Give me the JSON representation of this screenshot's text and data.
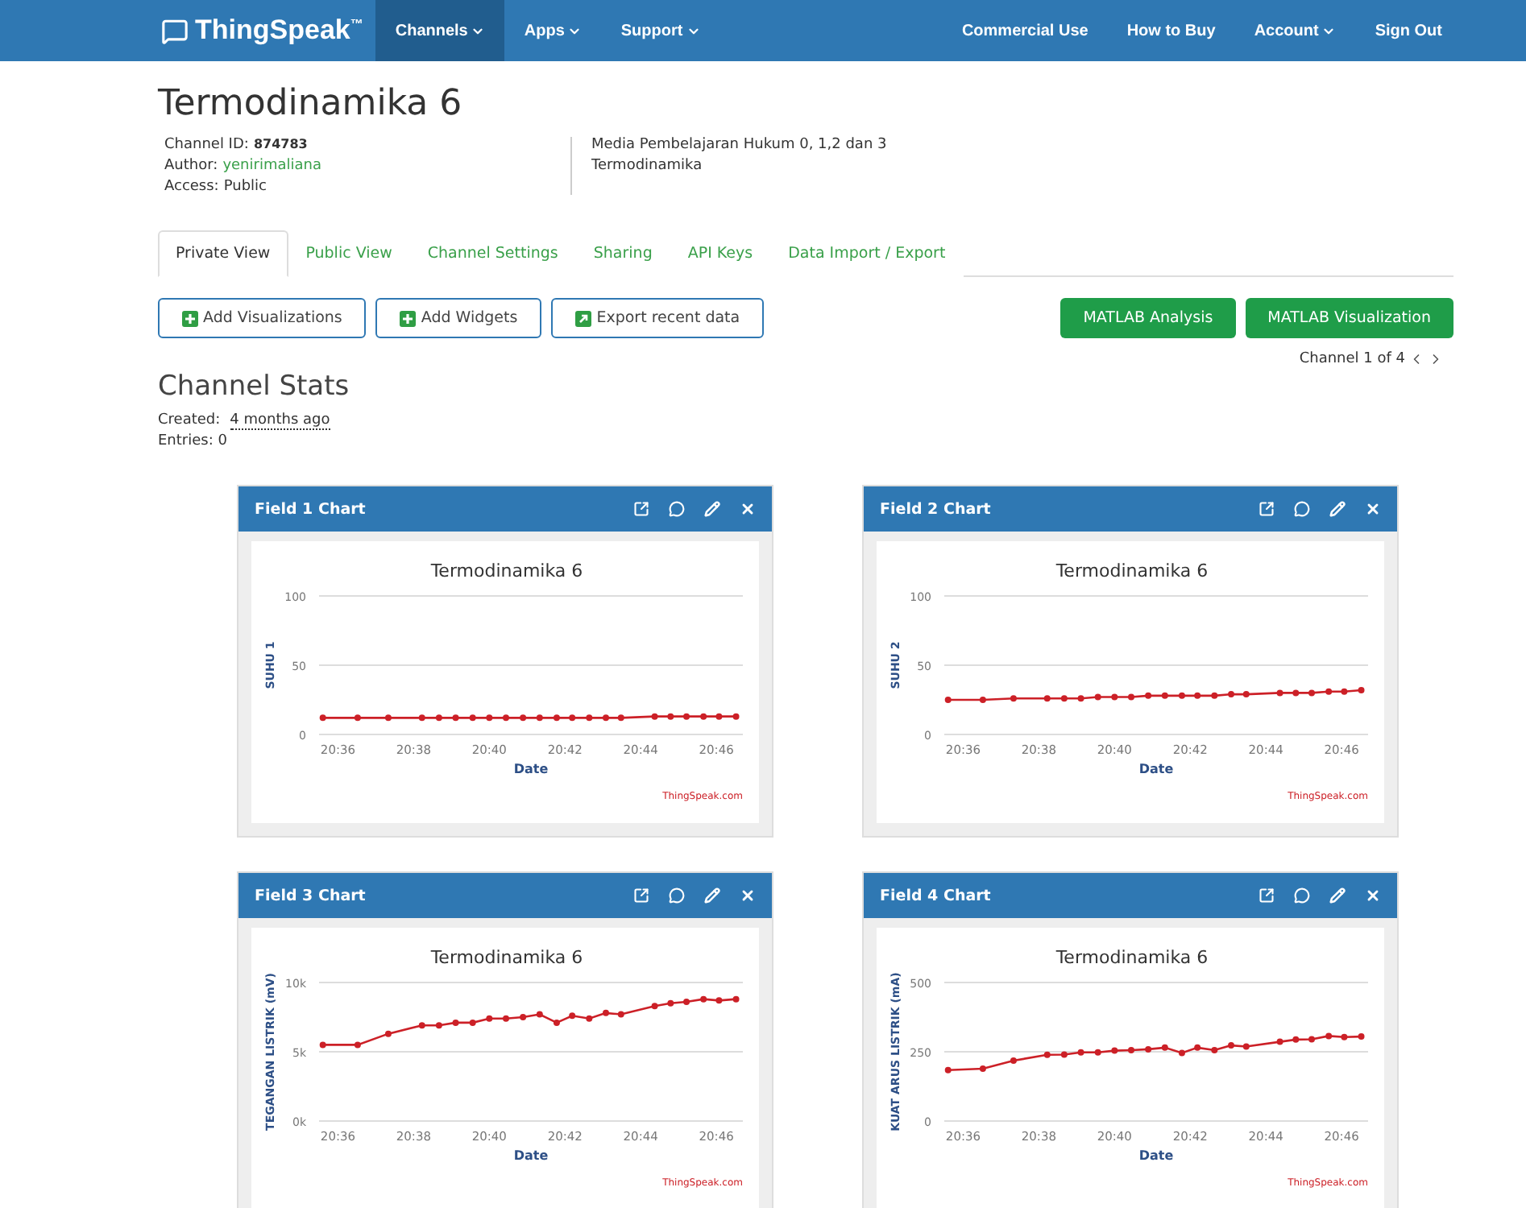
{
  "nav": {
    "logo": "ThingSpeak$^{™}$",
    "left": [
      {
        "label": "Channels",
        "menu": true,
        "selected": true
      },
      {
        "label": "Apps",
        "menu": true,
        "selected": false
      },
      {
        "label": "Support",
        "menu": true,
        "selected": false
      }
    ],
    "right": [
      {
        "label": "Commercial Use",
        "menu": false
      },
      {
        "label": "How to Buy",
        "menu": false
      },
      {
        "label": "Account",
        "menu": true
      },
      {
        "label": "Sign Out",
        "menu": false
      }
    ]
  },
  "channel": {
    "title": "Termodinamika 6",
    "meta": [
      {
        "label": "Channel ID:",
        "value": "874783",
        "kind": "bold"
      },
      {
        "label": "Author:",
        "value": "yenirimaliana",
        "kind": "link"
      },
      {
        "label": "Access:",
        "value": "Public",
        "kind": "plain"
      }
    ],
    "description": [
      "Media Pembelajaran Hukum 0, 1,2 dan 3",
      "Termodinamika"
    ]
  },
  "tabs": [
    {
      "label": "Private View",
      "selected": true
    },
    {
      "label": "Public View",
      "selected": false
    },
    {
      "label": "Channel Settings",
      "selected": false
    },
    {
      "label": "Sharing",
      "selected": false
    },
    {
      "label": "API Keys",
      "selected": false
    },
    {
      "label": "Data Import / Export",
      "selected": false
    }
  ],
  "actions": [
    {
      "label": "Add Visualizations",
      "kind": "plus"
    },
    {
      "label": "Add Widgets",
      "kind": "plus"
    },
    {
      "label": "Export recent data",
      "kind": "export"
    }
  ],
  "matlab": [
    "MATLAB Analysis",
    "MATLAB Visualization"
  ],
  "pager": "Channel 1 of 4",
  "stats": {
    "title": "Channel Stats",
    "created_label": "Created:",
    "created": "4 months ago",
    "entries": "Entries: 0"
  },
  "charts": [
    {
      "header": "Field 1 Chart",
      "credit": "ThingSpeak.com",
      "chart_data": {
        "type": "line",
        "title": "Termodinamika 6",
        "xlabel": "Date",
        "ylabel": "SUHU 1",
        "xlim": [
          1235.5,
          1246.7
        ],
        "ylim": [
          0,
          100
        ],
        "yticks": [
          0,
          50,
          100
        ],
        "xticks": [
          {
            "value": 1236,
            "label": "20:36"
          },
          {
            "value": 1238,
            "label": "20:38"
          },
          {
            "value": 1240,
            "label": "20:40"
          },
          {
            "value": 1242,
            "label": "20:42"
          },
          {
            "value": 1244,
            "label": "20:44"
          },
          {
            "value": 1246,
            "label": "20:46"
          }
        ],
        "x": [
          1235.6,
          1236.52,
          1237.33,
          1238.22,
          1238.67,
          1239.11,
          1239.56,
          1240,
          1240.44,
          1240.89,
          1241.33,
          1241.78,
          1242.19,
          1242.64,
          1243.08,
          1243.48,
          1244.37,
          1244.79,
          1245.21,
          1245.66,
          1246.07,
          1246.52
        ],
        "series": [
          {
            "color": "#cc2027",
            "marker": "circle",
            "values": [
              12,
              12,
              12,
              12,
              12,
              12,
              12,
              12,
              12,
              12,
              12,
              12,
              12,
              12,
              12,
              12,
              13,
              13,
              13,
              13,
              13,
              13
            ]
          }
        ]
      }
    },
    {
      "header": "Field 2 Chart",
      "credit": "ThingSpeak.com",
      "chart_data": {
        "type": "line",
        "title": "Termodinamika 6",
        "xlabel": "Date",
        "ylabel": "SUHU 2",
        "xlim": [
          1235.5,
          1246.7
        ],
        "ylim": [
          0,
          100
        ],
        "yticks": [
          0,
          50,
          100
        ],
        "xticks": [
          {
            "value": 1236,
            "label": "20:36"
          },
          {
            "value": 1238,
            "label": "20:38"
          },
          {
            "value": 1240,
            "label": "20:40"
          },
          {
            "value": 1242,
            "label": "20:42"
          },
          {
            "value": 1244,
            "label": "20:44"
          },
          {
            "value": 1246,
            "label": "20:46"
          }
        ],
        "x": [
          1235.6,
          1236.52,
          1237.33,
          1238.22,
          1238.67,
          1239.11,
          1239.56,
          1240,
          1240.44,
          1240.89,
          1241.33,
          1241.78,
          1242.19,
          1242.64,
          1243.08,
          1243.48,
          1244.37,
          1244.79,
          1245.21,
          1245.66,
          1246.07,
          1246.52
        ],
        "series": [
          {
            "color": "#cc2027",
            "marker": "circle",
            "values": [
              25,
              25,
              26,
              26,
              26,
              26,
              27,
              27,
              27,
              28,
              28,
              28,
              28,
              28,
              29,
              29,
              30,
              30,
              30,
              31,
              31,
              32
            ]
          }
        ]
      }
    },
    {
      "header": "Field 3 Chart",
      "credit": "ThingSpeak.com",
      "chart_data": {
        "type": "line",
        "title": "Termodinamika 6",
        "xlabel": "Date",
        "ylabel": "TEGANGAN LISTRIK (mV)",
        "xlim": [
          1235.5,
          1246.7
        ],
        "ylim": [
          0,
          10000
        ],
        "yticks": [
          {
            "value": 0,
            "label": "0k"
          },
          {
            "value": 5000,
            "label": "5k"
          },
          {
            "value": 10000,
            "label": "10k"
          }
        ],
        "xticks": [
          {
            "value": 1236,
            "label": "20:36"
          },
          {
            "value": 1238,
            "label": "20:38"
          },
          {
            "value": 1240,
            "label": "20:40"
          },
          {
            "value": 1242,
            "label": "20:42"
          },
          {
            "value": 1244,
            "label": "20:44"
          },
          {
            "value": 1246,
            "label": "20:46"
          }
        ],
        "x": [
          1235.6,
          1236.52,
          1237.33,
          1238.22,
          1238.67,
          1239.11,
          1239.56,
          1240,
          1240.44,
          1240.89,
          1241.33,
          1241.78,
          1242.19,
          1242.64,
          1243.08,
          1243.48,
          1244.37,
          1244.79,
          1245.21,
          1245.66,
          1246.07,
          1246.52
        ],
        "series": [
          {
            "color": "#cc2027",
            "marker": "circle",
            "values": [
              5500,
              5500,
              6300,
              6900,
              6900,
              7100,
              7100,
              7400,
              7400,
              7500,
              7700,
              7100,
              7600,
              7400,
              7800,
              7700,
              8300,
              8500,
              8600,
              8800,
              8700,
              8800
            ]
          }
        ]
      }
    },
    {
      "header": "Field 4 Chart",
      "credit": "ThingSpeak.com",
      "chart_data": {
        "type": "line",
        "title": "Termodinamika 6",
        "xlabel": "Date",
        "ylabel": "KUAT ARUS LISTRIK (mA)",
        "xlim": [
          1235.5,
          1246.7
        ],
        "ylim": [
          0,
          500
        ],
        "yticks": [
          0,
          250,
          500
        ],
        "xticks": [
          {
            "value": 1236,
            "label": "20:36"
          },
          {
            "value": 1238,
            "label": "20:38"
          },
          {
            "value": 1240,
            "label": "20:40"
          },
          {
            "value": 1242,
            "label": "20:42"
          },
          {
            "value": 1244,
            "label": "20:44"
          },
          {
            "value": 1246,
            "label": "20:46"
          }
        ],
        "x": [
          1235.6,
          1236.52,
          1237.33,
          1238.22,
          1238.67,
          1239.11,
          1239.56,
          1240,
          1240.44,
          1240.89,
          1241.33,
          1241.78,
          1242.19,
          1242.64,
          1243.08,
          1243.48,
          1244.37,
          1244.79,
          1245.21,
          1245.66,
          1246.07,
          1246.52
        ],
        "series": [
          {
            "color": "#cc2027",
            "marker": "circle",
            "values": [
              184,
              189,
              218,
              239,
              240,
              248,
              248,
              254,
              256,
              259,
              265,
              246,
              265,
              256,
              273,
              269,
              286,
              294,
              295,
              307,
              303,
              305
            ]
          }
        ]
      }
    }
  ]
}
